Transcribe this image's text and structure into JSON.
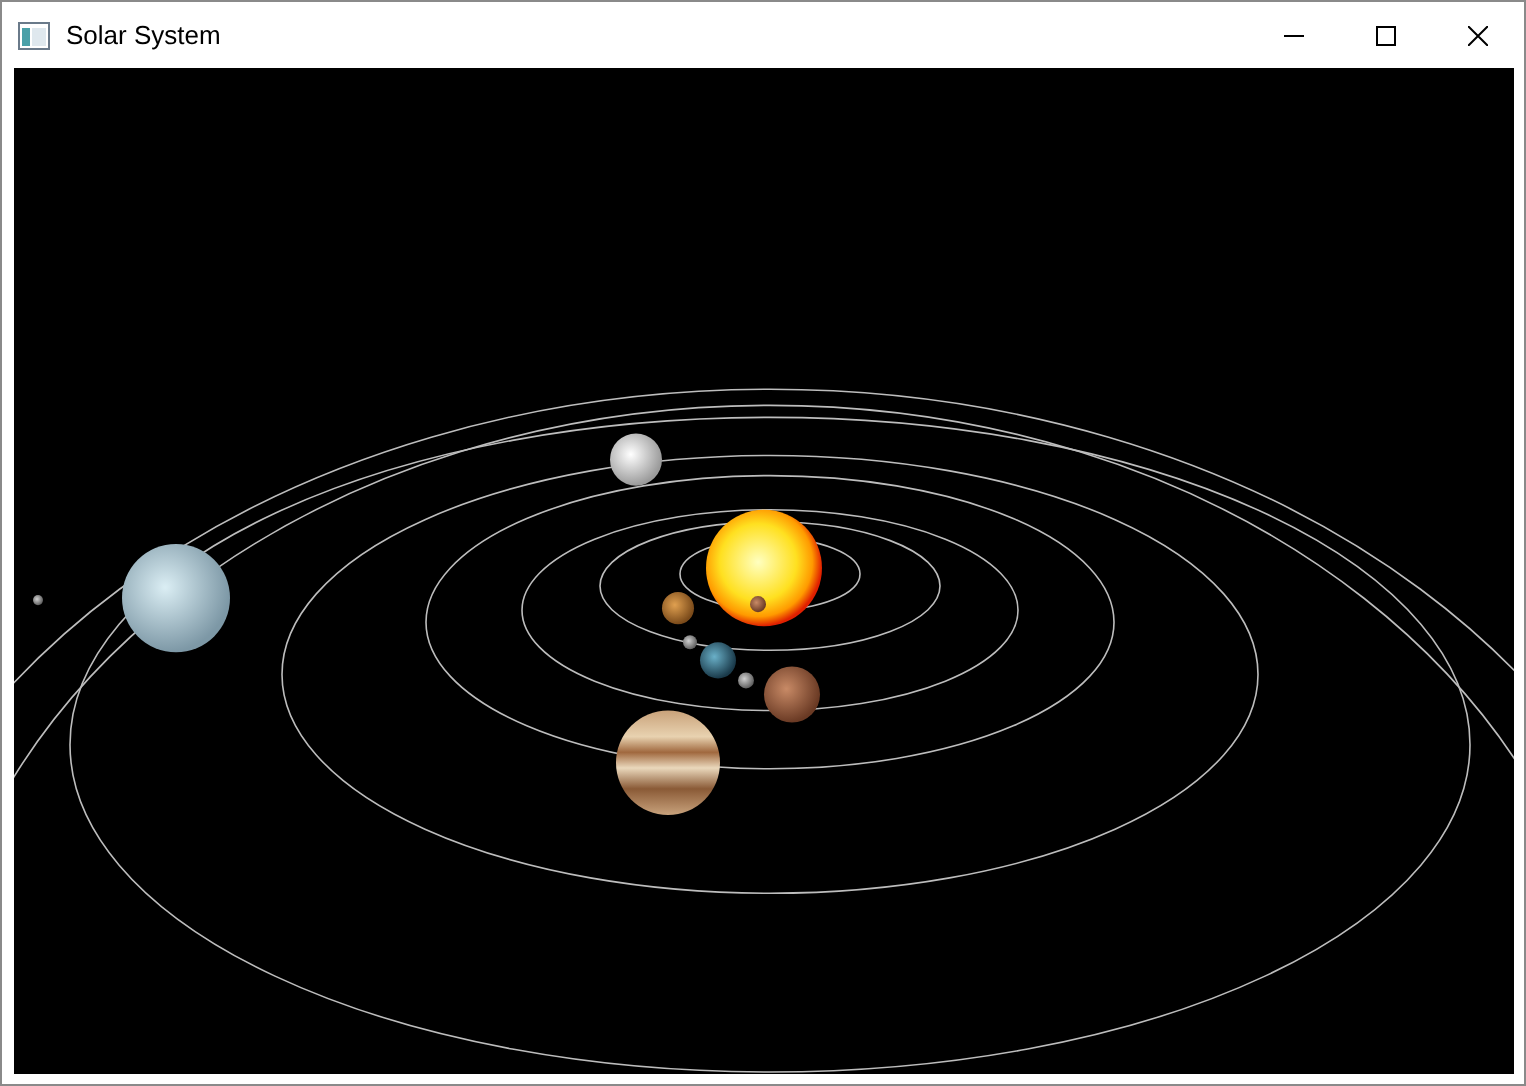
{
  "window": {
    "title": "Solar System"
  }
}
